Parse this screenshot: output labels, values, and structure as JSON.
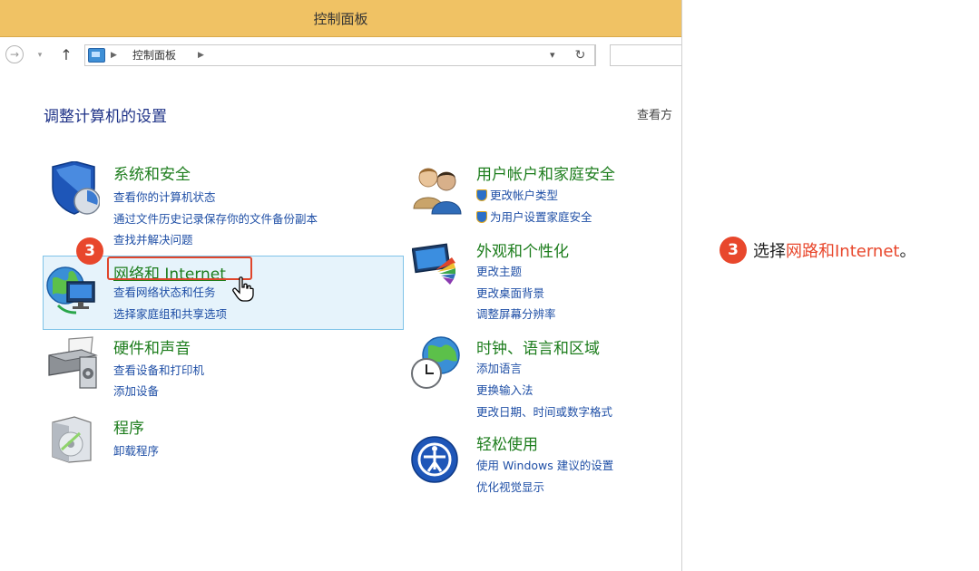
{
  "window": {
    "title": "控制面板",
    "breadcrumb": [
      "控制面板"
    ],
    "refresh_glyph": "↻"
  },
  "main": {
    "heading": "调整计算机的设置",
    "view_by": "查看方"
  },
  "categories": {
    "system": {
      "title": "系统和安全",
      "links": [
        "查看你的计算机状态",
        "通过文件历史记录保存你的文件备份副本",
        "查找并解决问题"
      ]
    },
    "network": {
      "title": "网络和 Internet",
      "links": [
        "查看网络状态和任务",
        "选择家庭组和共享选项"
      ]
    },
    "hardware": {
      "title": "硬件和声音",
      "links": [
        "查看设备和打印机",
        "添加设备"
      ]
    },
    "programs": {
      "title": "程序",
      "links": [
        "卸载程序"
      ]
    },
    "users": {
      "title": "用户帐户和家庭安全",
      "links": [
        "更改帐户类型",
        "为用户设置家庭安全"
      ]
    },
    "appearance": {
      "title": "外观和个性化",
      "links": [
        "更改主题",
        "更改桌面背景",
        "调整屏幕分辨率"
      ]
    },
    "clock": {
      "title": "时钟、语言和区域",
      "links": [
        "添加语言",
        "更换输入法",
        "更改日期、时间或数字格式"
      ]
    },
    "ease": {
      "title": "轻松使用",
      "links": [
        "使用 Windows 建议的设置",
        "优化视觉显示"
      ]
    }
  },
  "annotation": {
    "step": "3",
    "prefix": "选择",
    "highlight": "网路和Internet",
    "suffix": "。"
  },
  "colors": {
    "titlebar": "#f0c264",
    "category_title": "#1d7d1d",
    "link": "#1f4fa6",
    "accent_red": "#e8472c"
  }
}
